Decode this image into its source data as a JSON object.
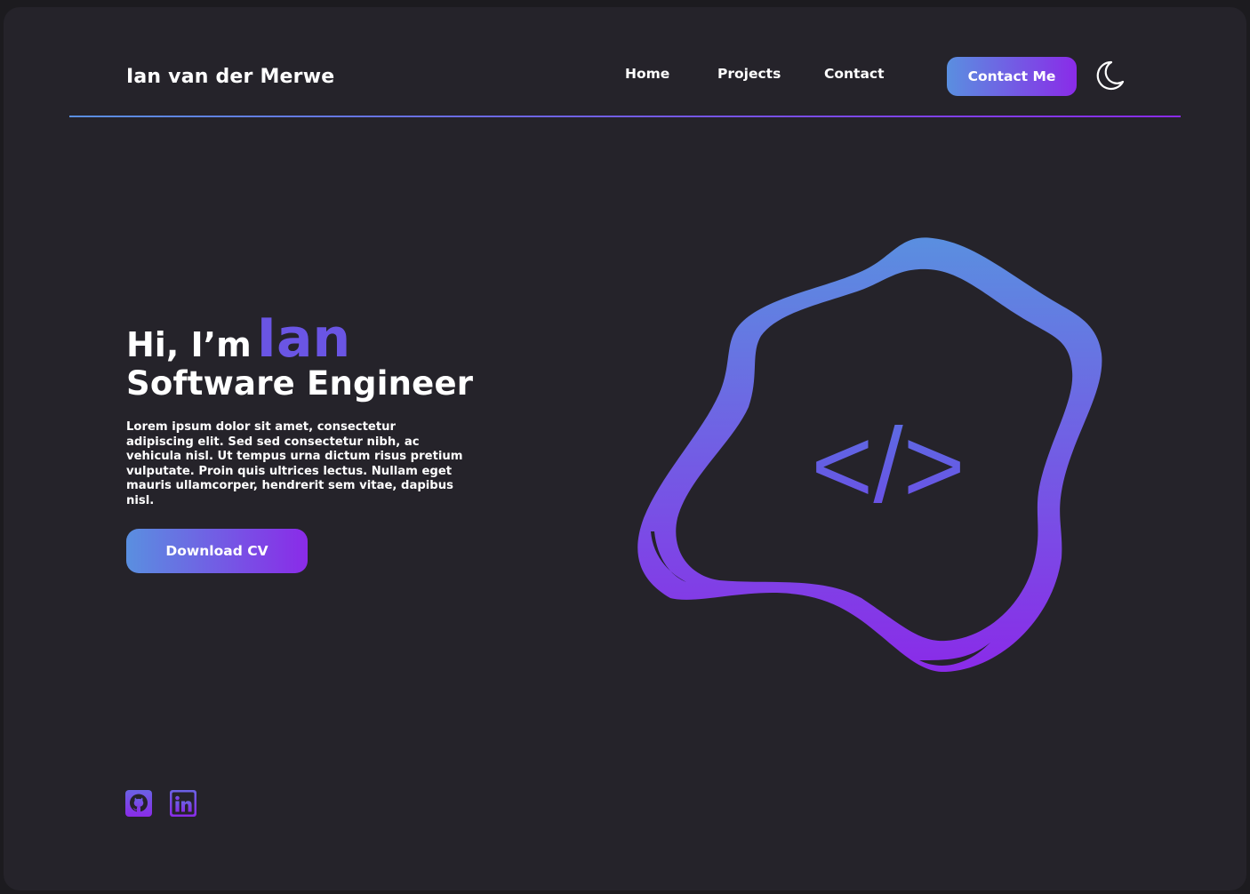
{
  "header": {
    "brand": "Ian van der Merwe",
    "nav": {
      "home": "Home",
      "projects": "Projects",
      "contact": "Contact"
    },
    "contact_button": "Contact Me",
    "theme_icon": "moon-icon"
  },
  "hero": {
    "greeting": "Hi, I’m",
    "name": "Ian",
    "role": "Software Engineer",
    "description": "Lorem ipsum dolor sit amet, consectetur adipiscing elit. Sed sed consectetur nibh, ac vehicula nisl. Ut tempus urna dictum risus pretium vulputate. Proin quis ultrices lectus. Nullam eget mauris ullamcorper, hendrerit sem vitae, dapibus nisl.",
    "cv_button": "Download CV",
    "illustration_text": "</>"
  },
  "social": {
    "github_icon": "github-icon",
    "linkedin_icon": "linkedin-icon"
  },
  "colors": {
    "background": "#25232a",
    "accent_start": "#5a8fe0",
    "accent_end": "#8a2be8",
    "name_accent": "#6a55e4",
    "text": "#ffffff"
  }
}
